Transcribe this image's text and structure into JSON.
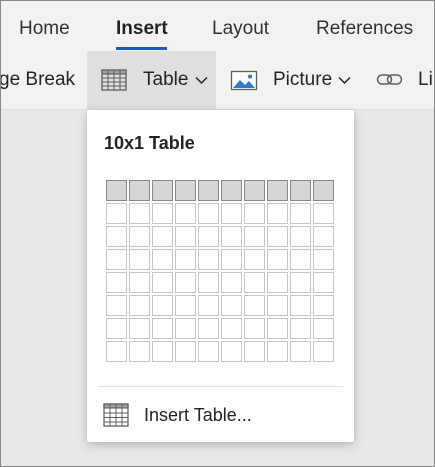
{
  "tabs": {
    "items": [
      {
        "label": "Home",
        "active": false
      },
      {
        "label": "Insert",
        "active": true
      },
      {
        "label": "Layout",
        "active": false
      },
      {
        "label": "References",
        "active": false
      }
    ]
  },
  "ribbon": {
    "page_break_label": "ge Break",
    "table_label": "Table",
    "picture_label": "Picture",
    "link_label": "Li"
  },
  "dropdown": {
    "title": "10x1 Table",
    "grid": {
      "columns": 10,
      "rows": 8,
      "selected_columns": 10,
      "selected_rows": 1
    },
    "insert_table_label": "Insert Table..."
  },
  "colors": {
    "accent": "#185abd",
    "grid_selected": "#d6d6d6",
    "grid_border": "#c8c6c4",
    "picture_icon": "#2e7bcf"
  }
}
